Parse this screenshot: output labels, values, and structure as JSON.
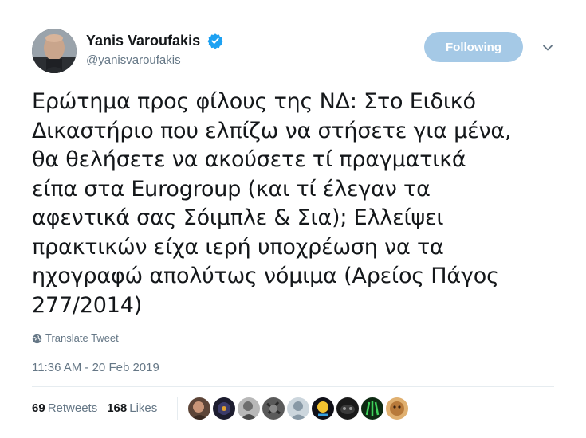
{
  "user": {
    "display_name": "Yanis Varoufakis",
    "handle": "@yanisvaroufakis",
    "verified": true
  },
  "follow_button": {
    "label": "Following",
    "color": "#a5c9e6"
  },
  "tweet": {
    "lines": [
      "Ερώτημα προς φίλους της ΝΔ: Στο Ειδικό",
      "Δικαστήριο που ελπίζω να στήσετε για μένα,",
      "θα θελήσετε να ακούσετε τί πραγματικά",
      "είπα στα Eurogroup (και τί έλεγαν τα",
      "αφεντικά σας Σόιμπλε & Σια); Ελλείψει",
      "πρακτικών είχα ιερή υποχρέωση να τα",
      "ηχογραφώ απολύτως νόμιμα (Αρείος Πάγος",
      "277/2014)"
    ]
  },
  "translate": {
    "label": "Translate Tweet",
    "icon": "globe-icon"
  },
  "timestamp": "11:36 AM - 20 Feb 2019",
  "stats": {
    "retweets_count": "69",
    "retweets_label": "Retweets",
    "likes_count": "168",
    "likes_label": "Likes"
  },
  "likers": [
    {
      "color": "#7a5a4a"
    },
    {
      "color": "#2b2b3a"
    },
    {
      "color": "#8a8a8a"
    },
    {
      "color": "#4a4a4a"
    },
    {
      "color": "#c4c9cf"
    },
    {
      "color": "#1a1a2a"
    },
    {
      "color": "#202020"
    },
    {
      "color": "#1f6b2a"
    },
    {
      "color": "#c9914a"
    }
  ],
  "colors": {
    "text": "#14171a",
    "secondary": "#657786",
    "verified": "#1da1f2",
    "divider": "#e6ecf0"
  }
}
